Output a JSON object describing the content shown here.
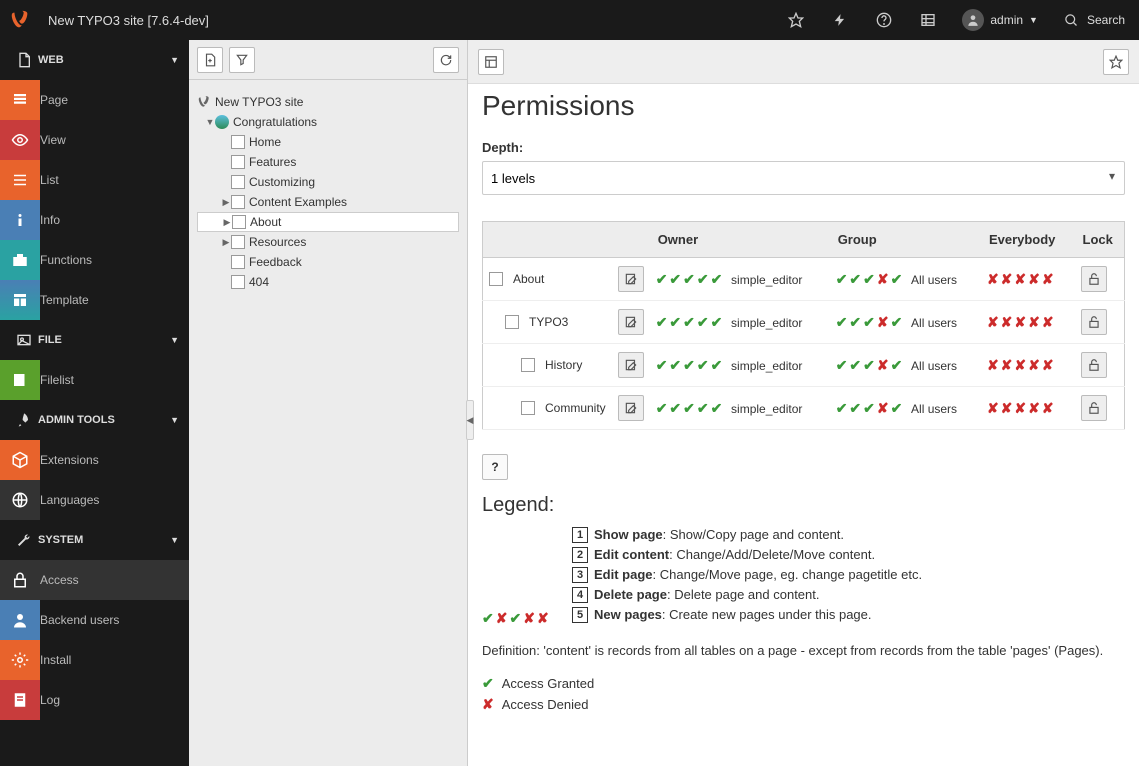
{
  "header": {
    "site_title": "New TYPO3 site [7.6.4-dev]",
    "user": "admin",
    "search": "Search"
  },
  "sidebar": {
    "sections": {
      "web": "WEB",
      "file": "FILE",
      "admin": "ADMIN TOOLS",
      "system": "SYSTEM"
    },
    "web_items": [
      "Page",
      "View",
      "List",
      "Info",
      "Functions",
      "Template"
    ],
    "file_items": [
      "Filelist"
    ],
    "admin_items": [
      "Extensions",
      "Languages"
    ],
    "system_items": [
      "Access",
      "Backend users",
      "Install",
      "Log"
    ]
  },
  "tree": {
    "root": "New TYPO3 site",
    "items": [
      "Congratulations",
      "Home",
      "Features",
      "Customizing",
      "Content Examples",
      "About",
      "Resources",
      "Feedback",
      "404"
    ]
  },
  "content": {
    "title": "Permissions",
    "depth_label": "Depth:",
    "depth_value": "1 levels",
    "th": {
      "owner": "Owner",
      "group": "Group",
      "everybody": "Everybody",
      "lock": "Lock"
    },
    "rows": [
      {
        "name": "About",
        "owner": "simple_editor",
        "group": "All users"
      },
      {
        "name": "TYPO3",
        "owner": "simple_editor",
        "group": "All users"
      },
      {
        "name": "History",
        "owner": "simple_editor",
        "group": "All users"
      },
      {
        "name": "Community",
        "owner": "simple_editor",
        "group": "All users"
      }
    ],
    "help": "?",
    "legend_title": "Legend:",
    "legend": [
      {
        "n": "1",
        "t": "Show page",
        "d": ": Show/Copy page and content."
      },
      {
        "n": "2",
        "t": "Edit content",
        "d": ": Change/Add/Delete/Move content."
      },
      {
        "n": "3",
        "t": "Edit page",
        "d": ": Change/Move page, eg. change pagetitle etc."
      },
      {
        "n": "4",
        "t": "Delete page",
        "d": ": Delete page and content."
      },
      {
        "n": "5",
        "t": "New pages",
        "d": ": Create new pages under this page."
      }
    ],
    "definition": "Definition: 'content' is records from all tables on a page - except from records from the table 'pages' (Pages).",
    "granted": "Access Granted",
    "denied": "Access Denied"
  }
}
